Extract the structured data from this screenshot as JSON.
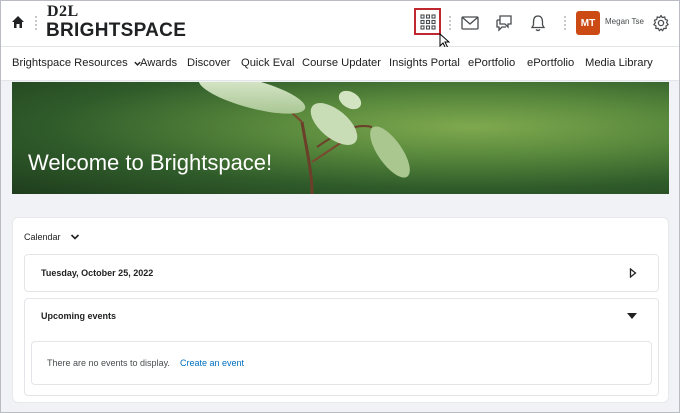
{
  "header": {
    "logo_top": "D2L",
    "logo_main": "BRIGHTSPACE",
    "user_initials": "MT",
    "user_name": "Megan Tse",
    "avatar_color": "#cc4a14"
  },
  "nav": {
    "items": [
      "Brightspace Resources",
      "Awards",
      "Discover",
      "Quick Eval",
      "Course Updater",
      "Insights Portal",
      "ePortfolio",
      "ePortfolio",
      "Media Library"
    ]
  },
  "banner": {
    "title": "Welcome to Brightspace!"
  },
  "calendar": {
    "label": "Calendar",
    "date": "Tuesday, October 25, 2022",
    "upcoming_title": "Upcoming events",
    "empty_message": "There are no events to display.",
    "create_link": "Create an event"
  },
  "colors": {
    "highlight_border": "#c0282f",
    "link": "#006fbf"
  }
}
